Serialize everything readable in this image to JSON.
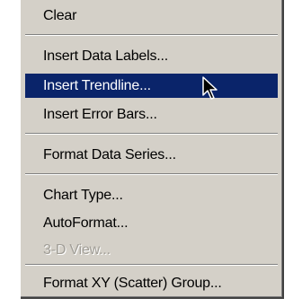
{
  "menu": {
    "items": [
      {
        "label": "Clear",
        "state": "normal"
      },
      {
        "label": "Insert Data Labels...",
        "state": "normal"
      },
      {
        "label": "Insert Trendline...",
        "state": "highlighted"
      },
      {
        "label": "Insert Error Bars...",
        "state": "normal"
      },
      {
        "label": "Format Data Series...",
        "state": "normal"
      },
      {
        "label": "Chart Type...",
        "state": "normal"
      },
      {
        "label": "AutoFormat...",
        "state": "normal"
      },
      {
        "label": "3-D View...",
        "state": "disabled"
      },
      {
        "label": "Format XY (Scatter) Group...",
        "state": "normal"
      }
    ]
  },
  "colors": {
    "menu_background": "#d4d0c8",
    "highlight": "#0a246a",
    "highlight_text": "#ffffff",
    "disabled_text": "#a09d96"
  },
  "cursor": {
    "icon": "arrow-pointer-icon"
  }
}
